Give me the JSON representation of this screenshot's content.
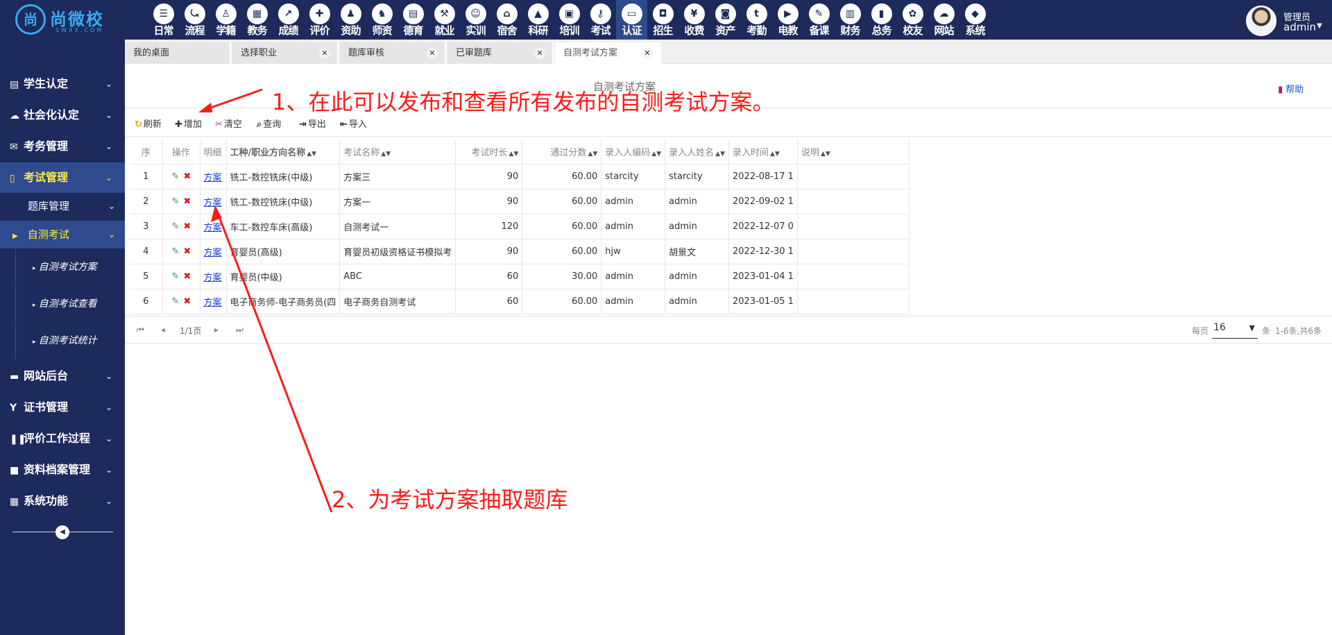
{
  "brand": {
    "logo_mark": "尚",
    "name": "尚微校",
    "sub": "SWXX.COM"
  },
  "modules": [
    {
      "label": "日常",
      "icon": "list-icon",
      "glyph": "☰"
    },
    {
      "label": "流程",
      "icon": "flow-icon",
      "glyph": "⤿"
    },
    {
      "label": "学籍",
      "icon": "student-icon",
      "glyph": "♙"
    },
    {
      "label": "教务",
      "icon": "calendar-icon",
      "glyph": "▦"
    },
    {
      "label": "成绩",
      "icon": "chart-icon",
      "glyph": "↗"
    },
    {
      "label": "评价",
      "icon": "calendar-plus-icon",
      "glyph": "✚"
    },
    {
      "label": "资助",
      "icon": "person-icon",
      "glyph": "♟"
    },
    {
      "label": "师资",
      "icon": "teacher-icon",
      "glyph": "♞"
    },
    {
      "label": "德育",
      "icon": "book-icon",
      "glyph": "▤"
    },
    {
      "label": "就业",
      "icon": "gavel-icon",
      "glyph": "⚒"
    },
    {
      "label": "实训",
      "icon": "robot-icon",
      "glyph": "☺"
    },
    {
      "label": "宿舍",
      "icon": "home-icon",
      "glyph": "⌂"
    },
    {
      "label": "科研",
      "icon": "graduation-icon",
      "glyph": "▲"
    },
    {
      "label": "培训",
      "icon": "image-icon",
      "glyph": "▣"
    },
    {
      "label": "考试",
      "icon": "key-icon",
      "glyph": "⚷"
    },
    {
      "label": "认证",
      "icon": "monitor-icon",
      "glyph": "▭"
    },
    {
      "label": "招生",
      "icon": "bus-icon",
      "glyph": "◘"
    },
    {
      "label": "收费",
      "icon": "yen-icon",
      "glyph": "¥"
    },
    {
      "label": "资产",
      "icon": "train-icon",
      "glyph": "◙"
    },
    {
      "label": "考勤",
      "icon": "clock-icon",
      "glyph": "t"
    },
    {
      "label": "电教",
      "icon": "video-icon",
      "glyph": "▶"
    },
    {
      "label": "备课",
      "icon": "pencil-icon",
      "glyph": "✎"
    },
    {
      "label": "财务",
      "icon": "newspaper-icon",
      "glyph": "▥"
    },
    {
      "label": "总务",
      "icon": "bar-chart-icon",
      "glyph": "▮"
    },
    {
      "label": "校友",
      "icon": "group-icon",
      "glyph": "✿"
    },
    {
      "label": "网站",
      "icon": "cloud-icon",
      "glyph": "☁"
    },
    {
      "label": "系统",
      "icon": "cube-icon",
      "glyph": "◆"
    }
  ],
  "active_module": "认证",
  "user": {
    "role": "管理员",
    "name": "admin"
  },
  "sidebar": {
    "items": [
      {
        "label": "学生认定",
        "icon": "book-icon",
        "glyph": "▤"
      },
      {
        "label": "社会化认定",
        "icon": "cloud-icon",
        "glyph": "☁"
      },
      {
        "label": "考务管理",
        "icon": "envelope-icon",
        "glyph": "✉"
      },
      {
        "label": "考试管理",
        "icon": "document-icon",
        "glyph": "▯"
      },
      {
        "label": "网站后台",
        "icon": "folder-icon",
        "glyph": "▬"
      },
      {
        "label": "证书管理",
        "icon": "certificate-icon",
        "glyph": "Y"
      },
      {
        "label": "评价工作过程",
        "icon": "columns-icon",
        "glyph": "❚❚"
      },
      {
        "label": "资料档案管理",
        "icon": "square-icon",
        "glyph": "■"
      },
      {
        "label": "系统功能",
        "icon": "grid-icon",
        "glyph": "▦"
      }
    ],
    "sub": [
      "题库管理",
      "自测考试"
    ],
    "leaves": [
      "自测考试方案",
      "自测考试查看",
      "自测考试统计"
    ]
  },
  "tabs": [
    "我的桌面",
    "选择职业",
    "题库审核",
    "已审题库",
    "自测考试方案"
  ],
  "page": {
    "title": "自测考试方案",
    "help": "帮助"
  },
  "toolbar": [
    "刷新",
    "增加",
    "清空",
    "查询",
    "导出",
    "导入"
  ],
  "table": {
    "headers": [
      "序",
      "操作",
      "明细",
      "工种/职业方向名称",
      "考试名称",
      "考试时长",
      "通过分数",
      "录入人编码",
      "录入人姓名",
      "录入时间",
      "说明"
    ],
    "detail_link": "方案",
    "rows": [
      {
        "no": "1",
        "job": "铣工-数控铣床(中级)",
        "name": "方案三",
        "duration": "90",
        "score": "60.00",
        "code": "starcity",
        "person": "starcity",
        "time": "2022-08-17 1"
      },
      {
        "no": "2",
        "job": "铣工-数控铣床(中级)",
        "name": "方案一",
        "duration": "90",
        "score": "60.00",
        "code": "admin",
        "person": "admin",
        "time": "2022-09-02 1"
      },
      {
        "no": "3",
        "job": "车工-数控车床(高级)",
        "name": "自测考试一",
        "duration": "120",
        "score": "60.00",
        "code": "admin",
        "person": "admin",
        "time": "2022-12-07 0"
      },
      {
        "no": "4",
        "job": "育婴员(高级)",
        "name": "育婴员初级资格证书模拟考",
        "duration": "90",
        "score": "60.00",
        "code": "hjw",
        "person": "胡景文",
        "time": "2022-12-30 1"
      },
      {
        "no": "5",
        "job": "育婴员(中级)",
        "name": "ABC",
        "duration": "60",
        "score": "30.00",
        "code": "admin",
        "person": "admin",
        "time": "2023-01-04 1"
      },
      {
        "no": "6",
        "job": "电子商务师-电子商务员(四",
        "name": "电子商务自测考试",
        "duration": "60",
        "score": "60.00",
        "code": "admin",
        "person": "admin",
        "time": "2023-01-05 1"
      }
    ]
  },
  "pager": {
    "page": "1/1页",
    "per_page_label": "每页",
    "per_page": "16",
    "unit": "条",
    "summary": "1-6条,共6条"
  },
  "annotations": {
    "one": "1、在此可以发布和查看所有发布的自测考试方案。",
    "two": "2、为考试方案抽取题库"
  },
  "colors": {
    "nav_bg": "#1c2a5c",
    "active_text": "#ffeb3b",
    "annotation": "#ff1a1a"
  }
}
